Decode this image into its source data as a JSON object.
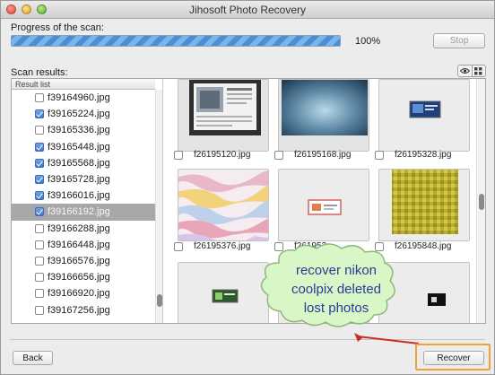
{
  "window": {
    "title": "Jihosoft Photo Recovery"
  },
  "progress": {
    "label": "Progress of the scan:",
    "percent": 100,
    "percent_text": "100%",
    "stop_label": "Stop"
  },
  "results": {
    "label": "Scan results:",
    "list_header": "Result list",
    "items": [
      {
        "name": "f39164960.jpg",
        "checked": false,
        "selected": false
      },
      {
        "name": "f39165224.jpg",
        "checked": true,
        "selected": false
      },
      {
        "name": "f39165336.jpg",
        "checked": false,
        "selected": false
      },
      {
        "name": "f39165448.jpg",
        "checked": true,
        "selected": false
      },
      {
        "name": "f39165568.jpg",
        "checked": true,
        "selected": false
      },
      {
        "name": "f39165728.jpg",
        "checked": true,
        "selected": false
      },
      {
        "name": "f39166016.jpg",
        "checked": true,
        "selected": false
      },
      {
        "name": "f39166192.jpg",
        "checked": true,
        "selected": true
      },
      {
        "name": "f39166288.jpg",
        "checked": false,
        "selected": false
      },
      {
        "name": "f39166448.jpg",
        "checked": false,
        "selected": false
      },
      {
        "name": "f39166576.jpg",
        "checked": false,
        "selected": false
      },
      {
        "name": "f39166656.jpg",
        "checked": false,
        "selected": false
      },
      {
        "name": "f39166920.jpg",
        "checked": false,
        "selected": false
      },
      {
        "name": "f39167256.jpg",
        "checked": false,
        "selected": false
      }
    ],
    "thumbnails": [
      {
        "caption": "f26195120.jpg"
      },
      {
        "caption": "f26195168.jpg"
      },
      {
        "caption": "f26195328.jpg"
      },
      {
        "caption": "f26195376.jpg"
      },
      {
        "caption": "f261952"
      },
      {
        "caption": "f26195848.jpg"
      }
    ]
  },
  "callout": {
    "lines": [
      "recover nikon",
      "coolpix deleted",
      "lost photos"
    ]
  },
  "buttons": {
    "back": "Back",
    "recover": "Recover"
  },
  "colors": {
    "callout_fill": "#d9f6c6",
    "callout_stroke": "#8fb77c",
    "arrow": "#c8302a",
    "highlight": "#f0a13a"
  },
  "icons": {
    "view_preview": "eye-icon",
    "view_grid": "grid-icon"
  }
}
